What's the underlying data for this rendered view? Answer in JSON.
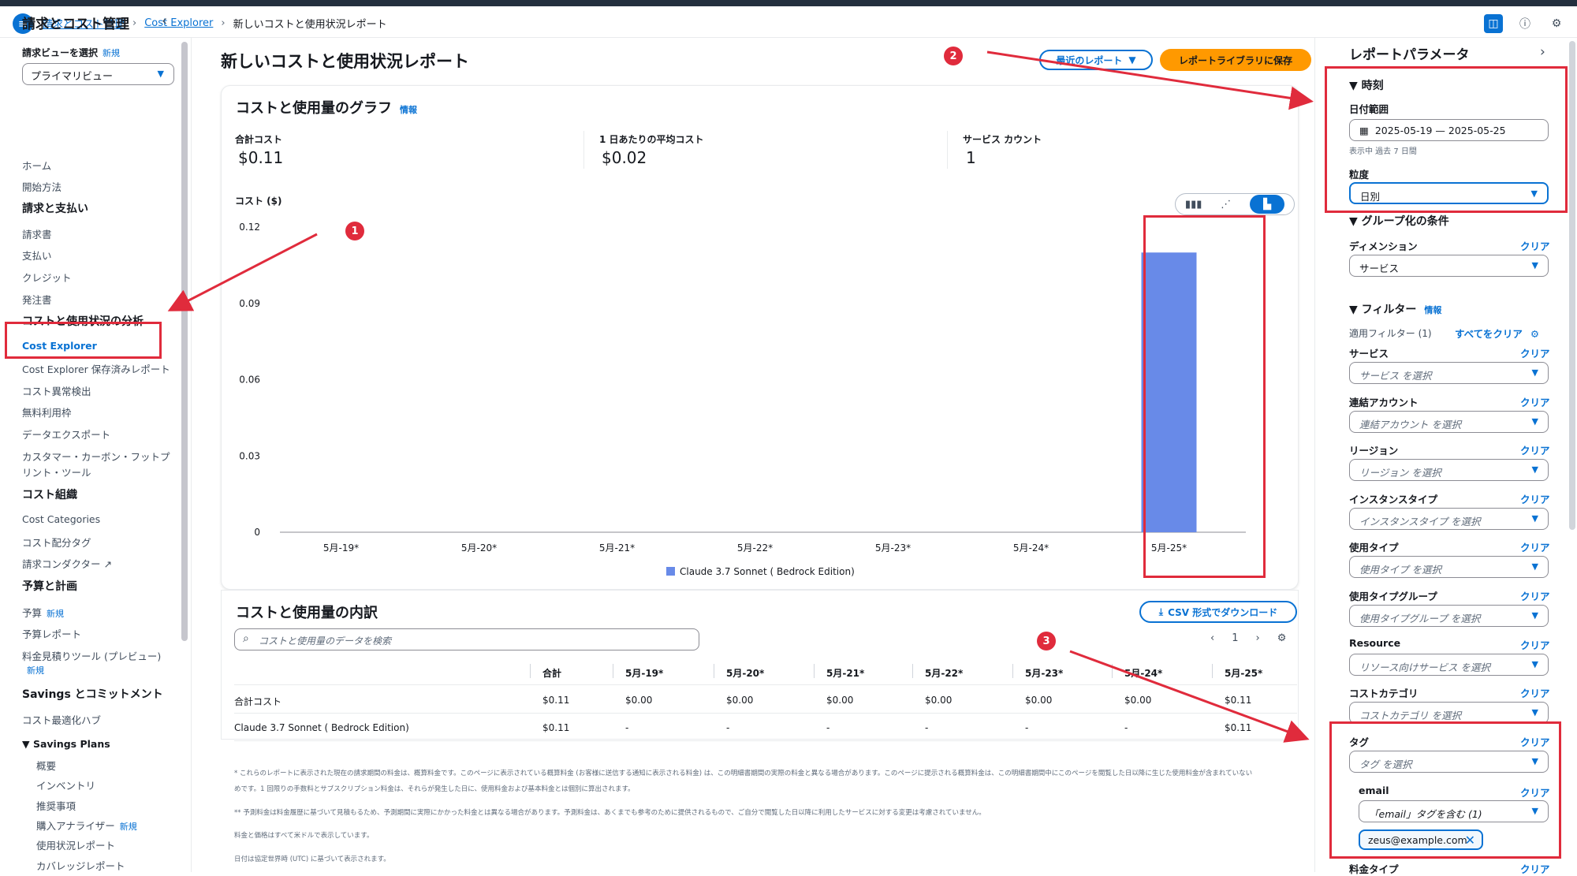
{
  "breadcrumb": [
    "請求とコスト管理",
    "Cost Explorer",
    "新しいコストと使用状況レポート"
  ],
  "leftnav": {
    "title": "請求とコスト管理",
    "view_label": "請求ビューを選択",
    "new_badge": "新規",
    "view_select": "プライマリビュー",
    "items": {
      "home": "ホーム",
      "getting_started": "開始方法",
      "billing_head": "請求と支払い",
      "bills": "請求書",
      "payments": "支払い",
      "credits": "クレジット",
      "purchase_orders": "発注書",
      "analysis_head": "コストと使用状況の分析",
      "cost_explorer": "Cost Explorer",
      "saved_reports": "Cost Explorer 保存済みレポート",
      "anomaly": "コスト異常検出",
      "free_tier": "無料利用枠",
      "data_exports": "データエクスポート",
      "carbon_1": "カスタマー・カーボン・フットプ",
      "carbon_2": "リント・ツール",
      "org_head": "コスト組織",
      "cost_categories": "Cost Categories",
      "cost_alloc_tags": "コスト配分タグ",
      "billing_conductor": "請求コンダクター",
      "budget_head": "予算と計画",
      "budgets": "予算",
      "budget_reports": "予算レポート",
      "pricing_calc": "料金見積りツール (プレビュー)",
      "savings_head": "Savings とコミットメント",
      "cost_opt_hub": "コスト最適化ハブ",
      "savings_plans": "Savings Plans",
      "overview": "概要",
      "inventory": "インベントリ",
      "recommendations": "推奨事項",
      "purchase_analyzer": "購入アナライザー",
      "utilization": "使用状況レポート",
      "coverage": "カバレッジレポート"
    }
  },
  "main": {
    "title": "新しいコストと使用状況レポート",
    "recent_reports": "最近のレポート",
    "save_to_library": "レポートライブラリに保存",
    "graph_panel_title": "コストと使用量のグラフ",
    "info": "情報",
    "metrics": [
      {
        "label": "合計コスト",
        "value": "$0.11"
      },
      {
        "label": "1 日あたりの平均コスト",
        "value": "$0.02"
      },
      {
        "label": "サービス カウント",
        "value": "1"
      }
    ],
    "breakdown_title": "コストと使用量の内訳",
    "csv_download": "CSV 形式でダウンロード",
    "search_placeholder": "コストと使用量のデータを検索",
    "page_number": "1",
    "table_headers": [
      "",
      "合計",
      "5月-19*",
      "5月-20*",
      "5月-21*",
      "5月-22*",
      "5月-23*",
      "5月-24*",
      "5月-25*"
    ],
    "table_rows": [
      [
        "合計コスト",
        "$0.11",
        "$0.00",
        "$0.00",
        "$0.00",
        "$0.00",
        "$0.00",
        "$0.00",
        "$0.11"
      ],
      [
        "Claude 3.7 Sonnet ( Bedrock Edition)",
        "$0.11",
        "-",
        "-",
        "-",
        "-",
        "-",
        "-",
        "$0.11"
      ]
    ],
    "footnotes": [
      "* これらのレポートに表示された現在の請求期間の料金は、概算料金です。このページに表示されている概算料金 (お客様に送信する通知に表示される料金) は、この明細書期間の実際の料金と異なる場合があります。このページに提示される概算料金は、この明細書期間中にこのページを閲覧した日以降に生じた使用料金が含まれていない",
      "めです。1 回限りの手数料とサブスクリプション料金は、それらが発生した日に、使用料金および基本料金とは個別に算出されます。",
      "** 予測料金は料金履歴に基づいて見積もるため、予測期間に実際にかかった料金とは異なる場合があります。予測料金は、あくまでも参考のために提供されるもので、ご自分で閲覧した日以降に利用したサービスに対する変更は考慮されていません。",
      "料金と価格はすべて米ドルで表示しています。",
      "日付は協定世界時 (UTC) に基づいて表示されます。"
    ]
  },
  "chart_data": {
    "type": "bar",
    "title": "",
    "ylabel": "コスト ($)",
    "xlabel": "",
    "categories": [
      "5月-19*",
      "5月-20*",
      "5月-21*",
      "5月-22*",
      "5月-23*",
      "5月-24*",
      "5月-25*"
    ],
    "series": [
      {
        "name": "Claude 3.7 Sonnet ( Bedrock Edition)",
        "values": [
          0,
          0,
          0,
          0,
          0,
          0,
          0.11
        ],
        "color": "#688ae8"
      }
    ],
    "ylim": [
      0,
      0.12
    ],
    "yticks": [
      "0.12",
      "0.09",
      "0.06",
      "0.03",
      "0"
    ],
    "legend": "bottom-center",
    "grid": true
  },
  "rightpanel": {
    "title": "レポートパラメータ",
    "time_section": "時刻",
    "date_range_label": "日付範囲",
    "date_range_value": "2025-05-19 — 2025-05-25",
    "date_range_hint": "表示中 過去 7 日間",
    "granularity_label": "粒度",
    "granularity_value": "日別",
    "group_section": "グループ化の条件",
    "dimension_label": "ディメンション",
    "dimension_value": "サービス",
    "clear": "クリア",
    "filter_section": "フィルター",
    "info": "情報",
    "applied_filters": "適用フィルター (1)",
    "clear_all": "すべてをクリア",
    "filters": [
      {
        "label": "サービス",
        "placeholder": "サービス を選択"
      },
      {
        "label": "連結アカウント",
        "placeholder": "連結アカウント を選択"
      },
      {
        "label": "リージョン",
        "placeholder": "リージョン を選択"
      },
      {
        "label": "インスタンスタイプ",
        "placeholder": "インスタンスタイプ を選択"
      },
      {
        "label": "使用タイプ",
        "placeholder": "使用タイプ を選択"
      },
      {
        "label": "使用タイプグループ",
        "placeholder": "使用タイプグループ を選択"
      },
      {
        "label": "Resource",
        "placeholder": "リソース向けサービス を選択"
      },
      {
        "label": "コストカテゴリ",
        "placeholder": "コストカテゴリ を選択"
      },
      {
        "label": "タグ",
        "placeholder": "タグ を選択"
      }
    ],
    "email_label": "email",
    "email_select": "「email」タグを含む (1)",
    "email_token": "zeus@example.com",
    "billing_type": "料金タイプ"
  },
  "annotations": [
    "1",
    "2",
    "3"
  ],
  "colors": {
    "accent": "#0972d3",
    "save_button": "#ff9900",
    "annotation_red": "#e02b3c",
    "bar": "#688ae8"
  }
}
